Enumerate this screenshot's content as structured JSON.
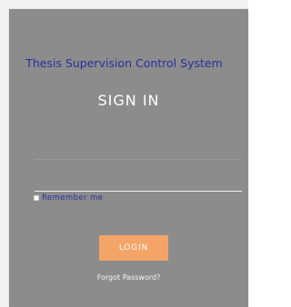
{
  "app": {
    "title": "Thesis Supervision Control System"
  },
  "form": {
    "heading": "SIGN IN",
    "username": {
      "value": "",
      "placeholder": ""
    },
    "password": {
      "value": "",
      "placeholder": ""
    },
    "remember_label": "Remember me",
    "login_label": "LOGIN",
    "forgot_label": "Forgot Password?"
  },
  "colors": {
    "card_background": "#8c8c8c",
    "title_text": "#2b2f9e",
    "login_button": "#f4a467"
  }
}
